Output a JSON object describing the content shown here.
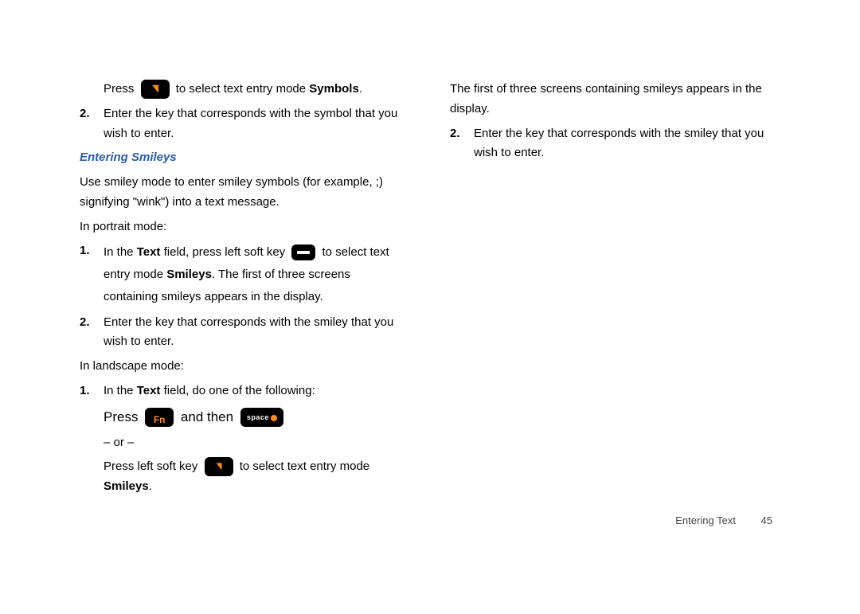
{
  "left": {
    "pressPrefix": "Press",
    "pressSuffix1": " to select text entry mode ",
    "symbolsWord": "Symbols",
    "period": ".",
    "step2num": "2.",
    "step2text": "Enter the key that corresponds with the symbol that you wish to enter.",
    "heading": "Entering Smileys",
    "intro": "Use smiley mode to enter smiley symbols (for example, ;) signifying \"wink\") into a text message.",
    "portraitLabel": "In portrait mode:",
    "p1num": "1.",
    "p1a": "In the ",
    "p1Text": "Text",
    "p1b": " field, press left soft key ",
    "p1c": " to select text entry mode ",
    "smileysWord": "Smileys",
    "p1d": ". The first of three screens containing smileys appears in the display.",
    "p2num": "2.",
    "p2text": "Enter the key that corresponds with the smiley that you wish to enter.",
    "landscapeLabel": "In landscape mode:",
    "l1num": "1.",
    "l1a": "In the ",
    "l1b": " field, do one of the following:",
    "fnPress": "Press ",
    "fnAndThen": " and then ",
    "or": "– or –",
    "softPrefix": "Press left soft key ",
    "softSuffix": " to select text entry mode ",
    "fnLabel": "Fn",
    "spaceLabel": "space"
  },
  "right": {
    "firstScreens": "The first of three screens containing smileys appears in the display.",
    "r2num": "2.",
    "r2text": "Enter the key that corresponds with the smiley that you wish to enter."
  },
  "footer": {
    "section": "Entering Text",
    "page": "45"
  }
}
